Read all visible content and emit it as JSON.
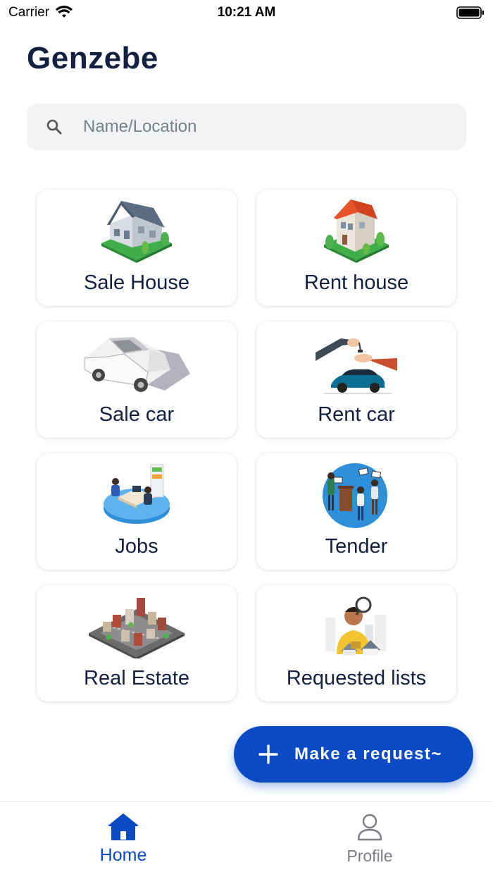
{
  "status_bar": {
    "carrier": "Carrier",
    "time": "10:21 AM"
  },
  "app": {
    "title": "Genzebe"
  },
  "search": {
    "placeholder": "Name/Location"
  },
  "categories": [
    {
      "label": "Sale House",
      "icon": "house-illustration"
    },
    {
      "label": "Rent house",
      "icon": "red-roof-house-illustration"
    },
    {
      "label": "Sale car",
      "icon": "sedan-car-illustration"
    },
    {
      "label": "Rent car",
      "icon": "car-key-handover-illustration"
    },
    {
      "label": "Jobs",
      "icon": "office-desk-illustration"
    },
    {
      "label": "Tender",
      "icon": "auction-illustration"
    },
    {
      "label": "Real Estate",
      "icon": "city-block-illustration"
    },
    {
      "label": "Requested lists",
      "icon": "house-search-illustration"
    }
  ],
  "fab": {
    "label": "Make a request~"
  },
  "tabs": {
    "home": "Home",
    "profile": "Profile"
  },
  "colors": {
    "accent": "#0a4ac5",
    "text": "#13203f",
    "muted": "#7a7d84"
  }
}
